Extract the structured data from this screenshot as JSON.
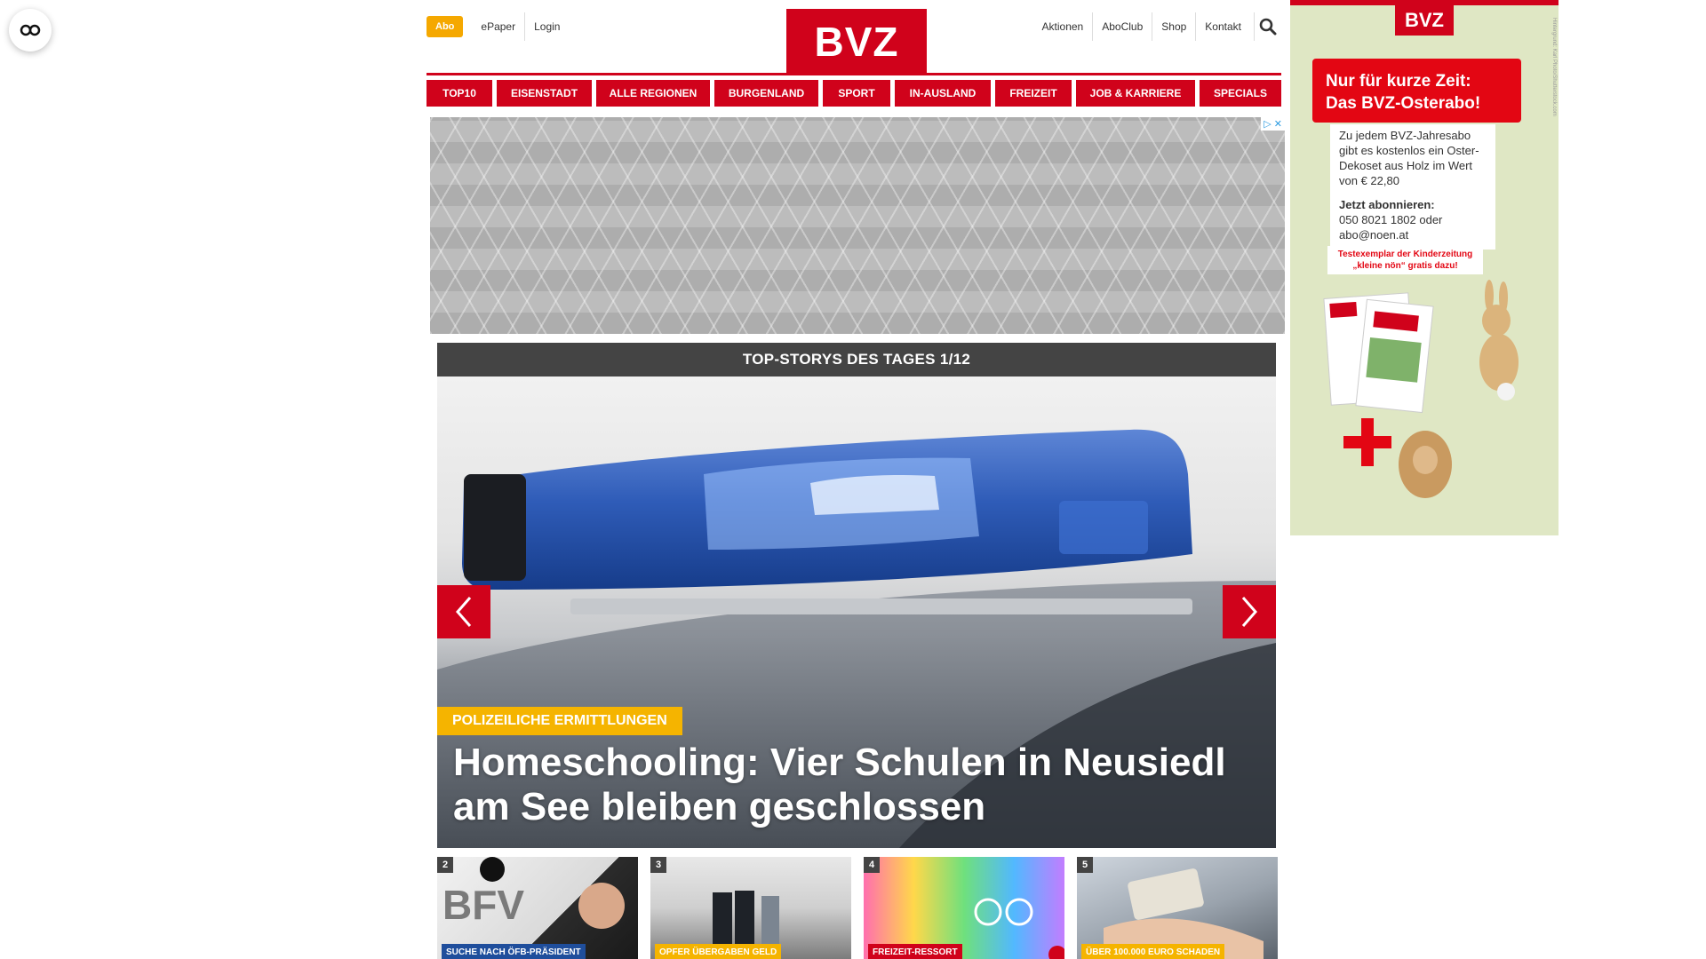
{
  "header": {
    "abo": "Abo",
    "left_links": [
      "ePaper",
      "Login"
    ],
    "logo": "BVZ",
    "right_links": [
      "Aktionen",
      "AboClub",
      "Shop",
      "Kontakt"
    ]
  },
  "nav": [
    "TOP10",
    "EISENSTADT",
    "ALLE REGIONEN",
    "BURGENLAND",
    "SPORT",
    "IN-AUSLAND",
    "FREIZEIT",
    "JOB & KARRIERE",
    "SPECIALS"
  ],
  "ad_banner": {
    "adchoices": "▷ ✕"
  },
  "top_stories": {
    "header": "TOP-STORYS DES TAGES 1/12",
    "hero": {
      "kicker": "POLIZEILICHE ERMITTLUNGEN",
      "headline": "Homeschooling: Vier Schulen in Neusiedl am See bleiben geschlossen"
    },
    "thumbs": [
      {
        "num": "2",
        "label": "SUCHE NACH ÖFB-PRÄSIDENT",
        "label_color": "#1f4e9c"
      },
      {
        "num": "3",
        "label": "OPFER ÜBERGABEN GELD",
        "label_color": "#f5b400"
      },
      {
        "num": "4",
        "label": "FREIZEIT-RESSORT",
        "label_color": "#d0021b"
      },
      {
        "num": "5",
        "label": "ÜBER 100.000 EURO SCHADEN",
        "label_color": "#f5b400"
      }
    ]
  },
  "side_ad": {
    "logo": "BVZ",
    "title_line1": "Nur für kurze Zeit:",
    "title_line2": "Das BVZ-Osterabo!",
    "body": "Zu jedem BVZ-Jahresabo gibt es kostenlos ein Oster-Dekoset aus Holz im Wert von € 22,80",
    "cta_title": "Jetzt abonnieren:",
    "cta_phone": "050 8021 1802 oder",
    "cta_email": "abo@noen.at",
    "strip_line1": "Testexemplar der Kinderzeitung",
    "strip_line2": "„kleine nön“ gratis dazu!",
    "vertical_note": "Hintergrund: Karl Photo/Shutterstock.com"
  },
  "colors": {
    "brand_red": "#d0021b",
    "accent_yellow": "#f5a800",
    "story_header": "#444444"
  }
}
